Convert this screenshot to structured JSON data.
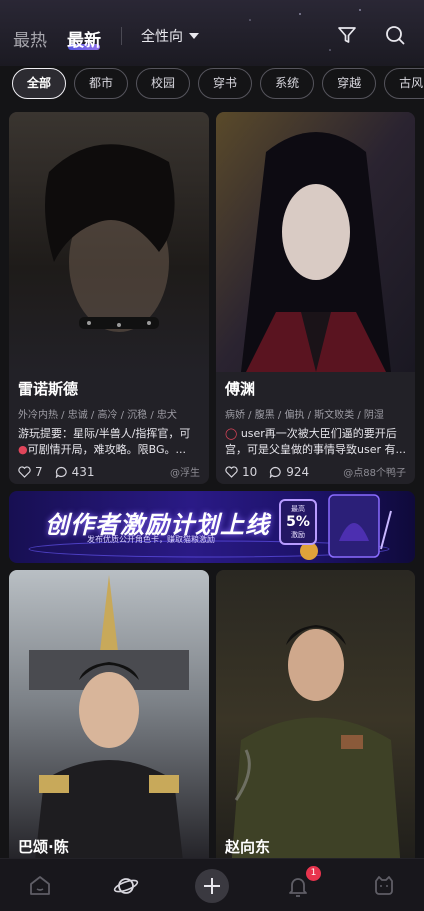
{
  "header": {
    "tab_hot": "最热",
    "tab_new": "最新",
    "gender_filter": "全性向"
  },
  "chips": [
    "全部",
    "都市",
    "校园",
    "穿书",
    "系统",
    "穿越",
    "古风"
  ],
  "cards": [
    {
      "name": "雷诺斯德",
      "tags": "外冷内热 / 忠诚 / 高冷 / 沉稳 / 忠犬",
      "desc_prefix": "游玩提要：星际/半兽人/指挥官，可",
      "desc_rest": "可剧情开局，难攻略。限BG。...",
      "likes": "7",
      "comments": "431",
      "author": "@浮生"
    },
    {
      "name": "傅渊",
      "tags": "病娇 / 腹黑 / 偏执 / 斯文败类 / 阴湿",
      "desc": "user再一次被大臣们逼的要开后宫，可是父皇做的事情导致user 有...",
      "likes": "10",
      "comments": "924",
      "author": "@点88个鸭子"
    },
    {
      "name": "巴颂·陈"
    },
    {
      "name": "赵向东"
    }
  ],
  "banner": {
    "title": "创作者激励计划上线",
    "subtitle": "发布优质公开角色卡，赚取猫粮激励",
    "badge_top": "最高",
    "badge_pct": "5%",
    "badge_bottom": "激励"
  },
  "nav": {
    "notification_count": "1"
  },
  "colors": {
    "background": "#141416",
    "card": "#222127",
    "accent": "#6f63ff",
    "badge": "#e8344e"
  }
}
